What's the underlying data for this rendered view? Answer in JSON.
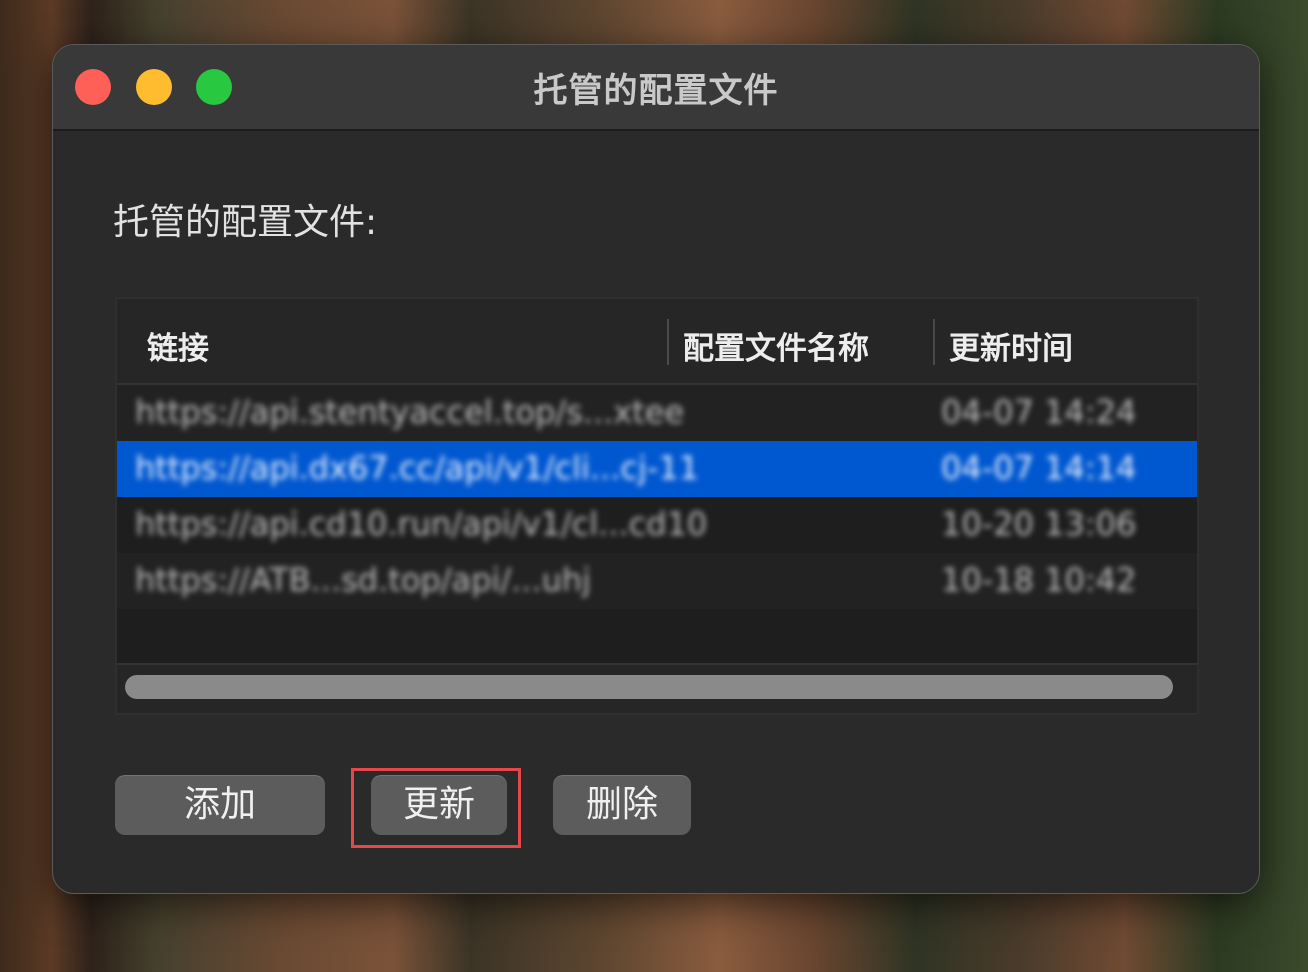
{
  "window": {
    "title": "托管的配置文件"
  },
  "main": {
    "section_label": "托管的配置文件:"
  },
  "table": {
    "columns": [
      "链接",
      "配置文件名称",
      "更新时间"
    ],
    "rows": [
      {
        "link": "https://api.stentyaccel.top/s...xtee",
        "name": "",
        "time": "04-07 14:24"
      },
      {
        "link": "https://api.dx67.cc/api/v1/cli...cj-11",
        "name": "",
        "time": "04-07 14:14"
      },
      {
        "link": "https://api.cd10.run/api/v1/cl...cd10",
        "name": "",
        "time": "10-20 13:06"
      },
      {
        "link": "https://ATB...sd.top/api/...uhj",
        "name": "",
        "time": "10-18 10:42"
      }
    ],
    "selected_row": 1
  },
  "buttons": {
    "add": "添加",
    "update": "更新",
    "delete": "删除"
  },
  "colors": {
    "selection": "#0058d0",
    "highlight_box": "#e8474a",
    "close": "#fe5f57",
    "minimize": "#febc2e",
    "maximize": "#28c840"
  }
}
